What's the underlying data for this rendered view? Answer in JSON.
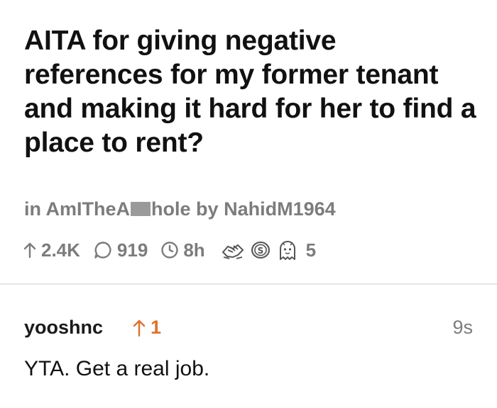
{
  "post": {
    "title": "AITA for giving negative references for my former tenant and making it hard for her to find a place to rent?",
    "subreddit_prefix": "in AmITheA",
    "subreddit_suffix": "hole",
    "by_label": "by",
    "author": "NahidM1964",
    "upvotes": "2.4K",
    "comments": "919",
    "age": "8h",
    "award_count": "5",
    "awards": [
      "handshake-award-icon",
      "silver-coin-award-icon",
      "ghost-award-icon"
    ]
  },
  "comment": {
    "author": "yooshnc",
    "score": "1",
    "age": "9s",
    "body": "YTA. Get a real job."
  },
  "colors": {
    "muted": "#7c7c7c",
    "upvote_accent": "#e0702f",
    "divider": "#e6e6e6"
  }
}
